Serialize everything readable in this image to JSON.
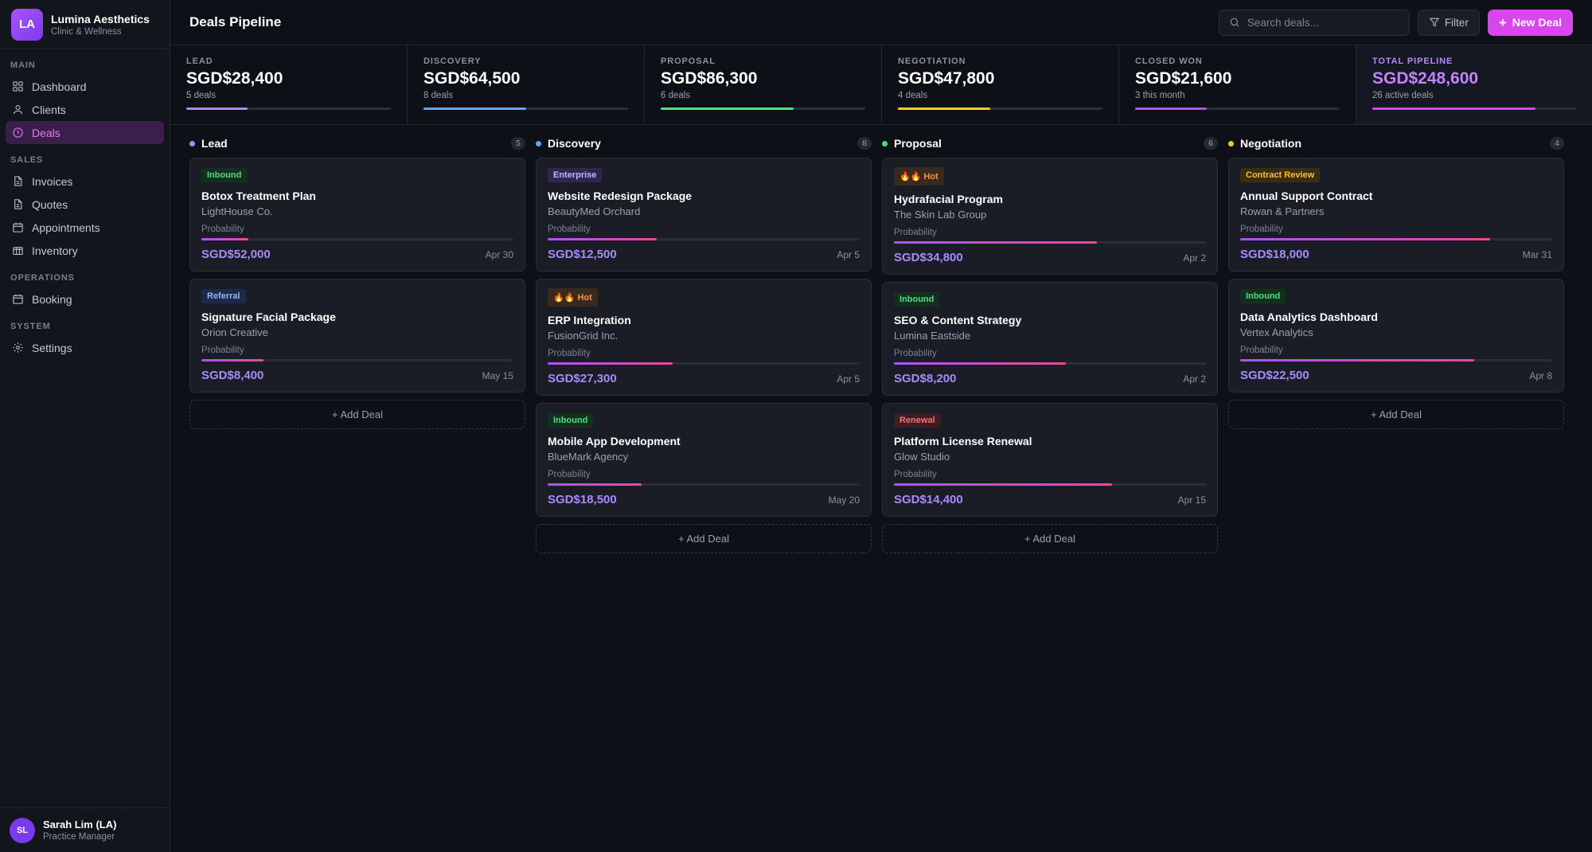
{
  "brand": {
    "initials": "LA",
    "name": "Lumina Aesthetics",
    "subtitle": "Clinic & Wellness"
  },
  "nav": [
    {
      "heading": "MAIN",
      "items": [
        {
          "label": "Dashboard",
          "icon": "grid-icon",
          "active": false
        },
        {
          "label": "Clients",
          "icon": "user-icon",
          "active": false
        },
        {
          "label": "Deals",
          "icon": "clock-icon",
          "active": true
        }
      ]
    },
    {
      "heading": "SALES",
      "items": [
        {
          "label": "Invoices",
          "icon": "document-icon",
          "active": false
        },
        {
          "label": "Quotes",
          "icon": "document-icon",
          "active": false
        },
        {
          "label": "Appointments",
          "icon": "calendar-icon",
          "active": false
        },
        {
          "label": "Inventory",
          "icon": "box-icon",
          "active": false
        }
      ]
    },
    {
      "heading": "OPERATIONS",
      "items": [
        {
          "label": "Booking",
          "icon": "calendar-icon",
          "active": false
        }
      ]
    },
    {
      "heading": "SYSTEM",
      "items": [
        {
          "label": "Settings",
          "icon": "gear-icon",
          "active": false
        }
      ]
    }
  ],
  "user": {
    "initials": "SL",
    "name": "Sarah Lim (LA)",
    "role": "Practice Manager"
  },
  "header": {
    "title": "Deals Pipeline",
    "search_placeholder": "Search deals...",
    "filter_label": "Filter",
    "new_label": "New Deal"
  },
  "stats": [
    {
      "label": "LEAD",
      "value": "SGD$28,400",
      "sub": "5 deals",
      "progress": 0.3,
      "color": "#a78bfa"
    },
    {
      "label": "DISCOVERY",
      "value": "SGD$64,500",
      "sub": "8 deals",
      "progress": 0.5,
      "color": "#60a5fa"
    },
    {
      "label": "PROPOSAL",
      "value": "SGD$86,300",
      "sub": "6 deals",
      "progress": 0.65,
      "color": "#4ade80"
    },
    {
      "label": "NEGOTIATION",
      "value": "SGD$47,800",
      "sub": "4 deals",
      "progress": 0.45,
      "color": "#facc15"
    },
    {
      "label": "CLOSED WON",
      "value": "SGD$21,600",
      "sub": "3 this month",
      "progress": 0.35,
      "color": "#a855f7"
    },
    {
      "label": "TOTAL PIPELINE",
      "value": "SGD$248,600",
      "sub": "26 active deals",
      "progress": 0.8,
      "color": "#d946ef",
      "total": true
    }
  ],
  "columns": [
    {
      "title": "Lead",
      "count": "5",
      "color": "#a78bfa",
      "add_label": "+ Add Deal",
      "cards": [
        {
          "tag": "Inbound",
          "tag_class": "Inbound",
          "title": "Botox Treatment Plan",
          "client": "LightHouse Co.",
          "prob_label": "Probability",
          "probability": 0.15,
          "value": "SGD$52,000",
          "date": "Apr 30"
        },
        {
          "tag": "Referral",
          "tag_class": "Referral",
          "title": "Signature Facial Package",
          "client": "Orion Creative",
          "prob_label": "Probability",
          "probability": 0.2,
          "value": "SGD$8,400",
          "date": "May 15"
        }
      ]
    },
    {
      "title": "Discovery",
      "count": "8",
      "color": "#60a5fa",
      "add_label": "+ Add Deal",
      "cards": [
        {
          "tag": "Enterprise",
          "tag_class": "Enterprise",
          "title": "Website Redesign Package",
          "client": "BeautyMed Orchard",
          "prob_label": "Probability",
          "probability": 0.35,
          "value": "SGD$12,500",
          "date": "Apr 5"
        },
        {
          "tag": "🔥🔥 Hot",
          "tag_class": "Hot",
          "title": "ERP Integration",
          "client": "FusionGrid Inc.",
          "prob_label": "Probability",
          "probability": 0.4,
          "value": "SGD$27,300",
          "date": "Apr 5"
        },
        {
          "tag": "Inbound",
          "tag_class": "Inbound",
          "title": "Mobile App Development",
          "client": "BlueMark Agency",
          "prob_label": "Probability",
          "probability": 0.3,
          "value": "SGD$18,500",
          "date": "May 20"
        }
      ]
    },
    {
      "title": "Proposal",
      "count": "6",
      "color": "#4ade80",
      "add_label": "+ Add Deal",
      "cards": [
        {
          "tag": "🔥🔥 Hot",
          "tag_class": "Hot",
          "title": "Hydrafacial Program",
          "client": "The Skin Lab Group",
          "prob_label": "Probability",
          "probability": 0.65,
          "value": "SGD$34,800",
          "date": "Apr 2"
        },
        {
          "tag": "Inbound",
          "tag_class": "Inbound",
          "title": "SEO & Content Strategy",
          "client": "Lumina Eastside",
          "prob_label": "Probability",
          "probability": 0.55,
          "value": "SGD$8,200",
          "date": "Apr 2"
        },
        {
          "tag": "Renewal",
          "tag_class": "Renewal",
          "title": "Platform License Renewal",
          "client": "Glow Studio",
          "prob_label": "Probability",
          "probability": 0.7,
          "value": "SGD$14,400",
          "date": "Apr 15"
        }
      ]
    },
    {
      "title": "Negotiation",
      "count": "4",
      "color": "#facc15",
      "add_label": "+ Add Deal",
      "cards": [
        {
          "tag": "Contract Review",
          "tag_class": "Contract",
          "title": "Annual Support Contract",
          "client": "Rowan & Partners",
          "prob_label": "Probability",
          "probability": 0.8,
          "value": "SGD$18,000",
          "date": "Mar 31"
        },
        {
          "tag": "Inbound",
          "tag_class": "Inbound",
          "title": "Data Analytics Dashboard",
          "client": "Vertex Analytics",
          "prob_label": "Probability",
          "probability": 0.75,
          "value": "SGD$22,500",
          "date": "Apr 8"
        }
      ]
    }
  ]
}
